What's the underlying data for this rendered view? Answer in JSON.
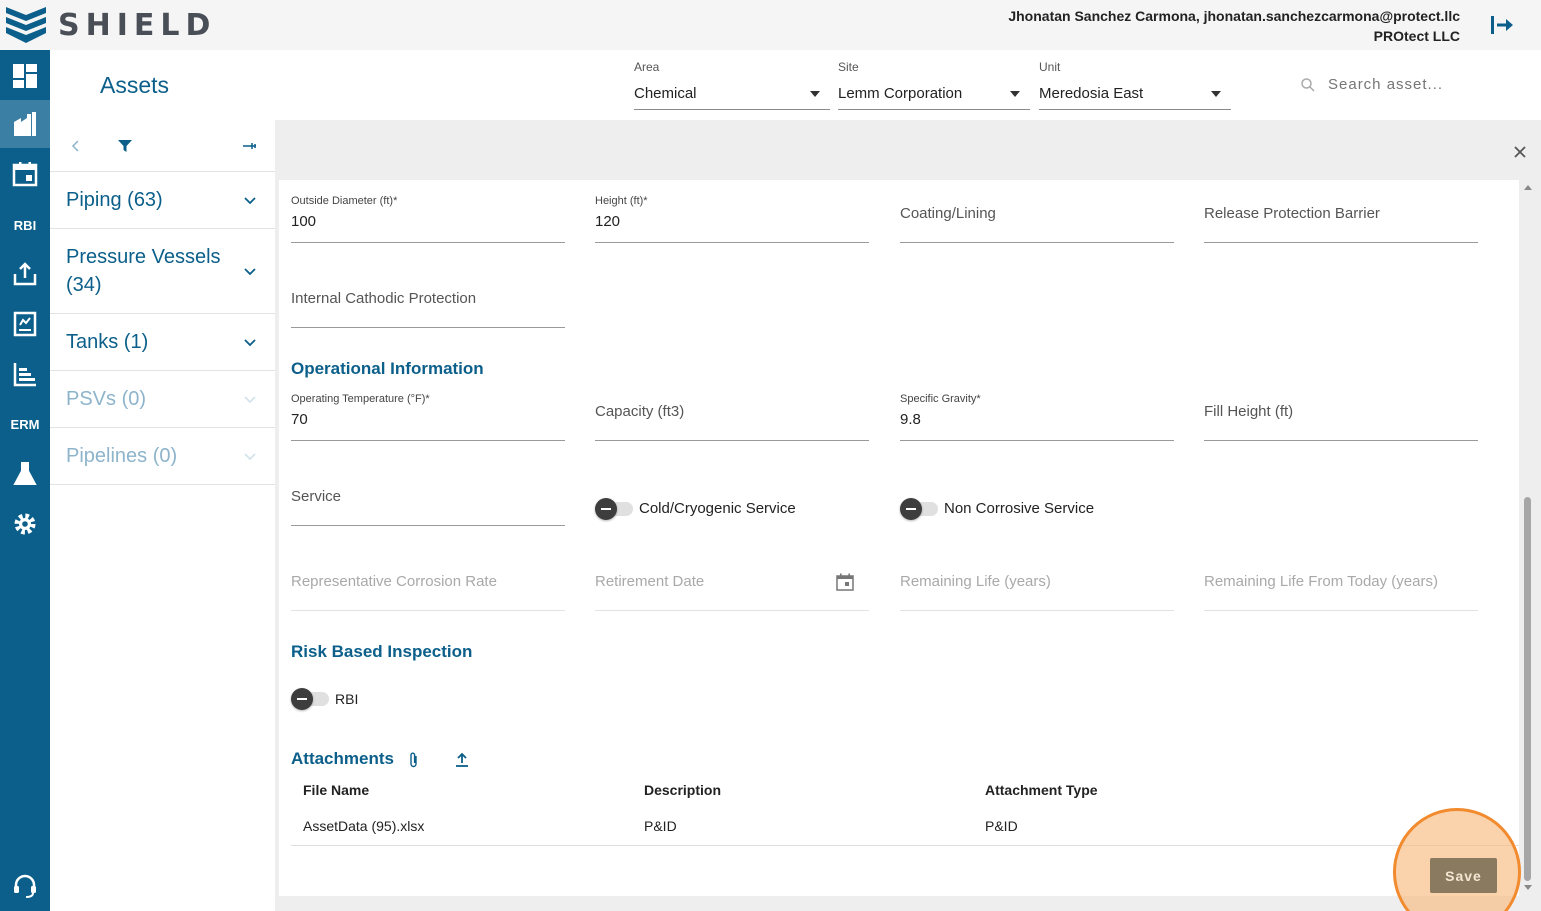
{
  "app": {
    "name": "SHIELD",
    "user_line": "Jhonatan Sanchez Carmona, jhonatan.sanchezcarmona@protect.llc",
    "org": "PROtect LLC"
  },
  "rail": {
    "labels": {
      "rbi": "RBI",
      "erm": "ERM"
    }
  },
  "sidebar": {
    "title": "Assets",
    "items": [
      {
        "label": "Piping (63)"
      },
      {
        "label": "Pressure Vessels (34)"
      },
      {
        "label": "Tanks (1)"
      },
      {
        "label": "PSVs (0)"
      },
      {
        "label": "Pipelines (0)"
      }
    ]
  },
  "filters": {
    "area": {
      "label": "Area",
      "value": "Chemical"
    },
    "site": {
      "label": "Site",
      "value": "Lemm Corporation"
    },
    "unit": {
      "label": "Unit",
      "value": "Meredosia East"
    },
    "search_placeholder": "Search asset..."
  },
  "form": {
    "outside_diameter": {
      "label": "Outside Diameter (ft)*",
      "value": "100"
    },
    "height": {
      "label": "Height (ft)*",
      "value": "120"
    },
    "coating": {
      "label": "Coating/Lining"
    },
    "release_barrier": {
      "label": "Release Protection Barrier"
    },
    "cathodic": {
      "label": "Internal Cathodic Protection"
    },
    "operational_heading": "Operational Information",
    "operating_temp": {
      "label": "Operating Temperature (°F)*",
      "value": "70"
    },
    "capacity": {
      "label": "Capacity (ft3)"
    },
    "specific_gravity": {
      "label": "Specific Gravity*",
      "value": "9.8"
    },
    "fill_height": {
      "label": "Fill Height (ft)"
    },
    "service": {
      "label": "Service"
    },
    "cold_service": "Cold/Cryogenic Service",
    "non_corrosive": "Non Corrosive Service",
    "corrosion_rate": {
      "label": "Representative Corrosion Rate"
    },
    "retirement_date": {
      "label": "Retirement Date"
    },
    "remaining_life": {
      "label": "Remaining Life (years)"
    },
    "remaining_life_today": {
      "label": "Remaining Life From Today (years)"
    },
    "rbi_heading": "Risk Based Inspection",
    "rbi_toggle": "RBI"
  },
  "attachments": {
    "heading": "Attachments",
    "columns": [
      "File Name",
      "Description",
      "Attachment Type"
    ],
    "rows": [
      {
        "file": "AssetData (95).xlsx",
        "description": "P&ID",
        "type": "P&ID"
      }
    ]
  },
  "actions": {
    "save": "Save"
  },
  "colors": {
    "brand": "#0b5f8a",
    "highlight": "#f28a2e"
  }
}
